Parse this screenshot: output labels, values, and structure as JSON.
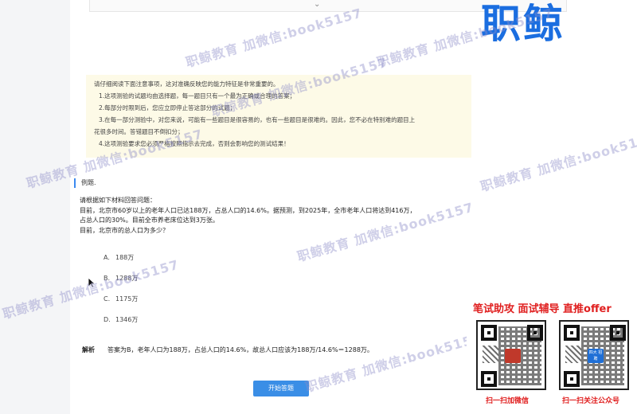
{
  "brand": {
    "logo_text": "职鲸"
  },
  "top_bar": {
    "chevron": "⌄"
  },
  "notice": {
    "intro": "请仔细阅读下面注意事项，这对准确反映您的能力特征是非常重要的。",
    "items": [
      "1.这项测验的试题均由选择题，每一题目只有一个最为正确或合理的答案；",
      "2.每部分时限到后，您应立即停止答这部分的试题；",
      "3.在每一部分测验中，对您来说，可能有一些题目是很容易的，也有一些题目是很难的。因此，您不必在特别难的题目上",
      "花很多时间。答错题目不倒扣分；",
      "4.这项测验要求您必须严格按照指示去完成，否则会影响您的测试结果！"
    ]
  },
  "example": {
    "title": "例题.",
    "question_lines": [
      "请根据如下材料回答问题：",
      "目前，北京市60岁以上的老年人口已达188万，占总人口的14.6%。据预测，到2025年，全市老年人口将达到416万，",
      "占总人口的30%。目前全市养老床位达到3万张。",
      "目前，北京市的总人口为多少？"
    ],
    "options": [
      {
        "letter": "A.",
        "text": "188万"
      },
      {
        "letter": "B.",
        "text": "1288万"
      },
      {
        "letter": "C.",
        "text": "1175万"
      },
      {
        "letter": "D.",
        "text": "1346万"
      }
    ],
    "analysis_label": "解析",
    "analysis_text": "答案为B，老年人口为188万，占总人口的14.6%，故总人口应该为188万/14.6%＝1288万。"
  },
  "start_button": {
    "label": "开始答题"
  },
  "watermark": {
    "text": "职鲸教育 加微信:book5157"
  },
  "ad": {
    "headline": "笔试助攻  面试辅导  直推offer",
    "qr_left_caption": "扫一扫加微信",
    "qr_right_caption": "扫一扫关注公众号",
    "qr_right_center": "四大\n招聘",
    "colors": {
      "headline": "#e02020",
      "center_badge": "#1f6fd6"
    }
  }
}
